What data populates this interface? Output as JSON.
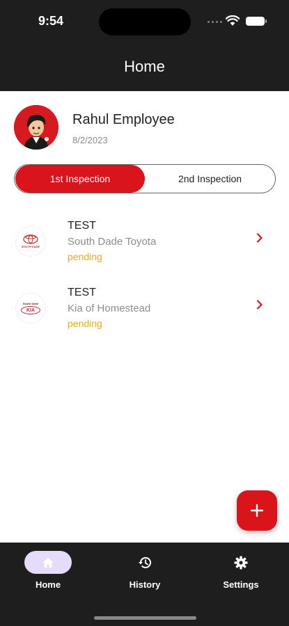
{
  "status_bar": {
    "time": "9:54"
  },
  "header": {
    "title": "Home"
  },
  "profile": {
    "name": "Rahul Employee",
    "date": "8/2/2023"
  },
  "segments": {
    "first": "1st Inspection",
    "second": "2nd Inspection",
    "selected": "1st Inspection"
  },
  "inspections": [
    {
      "title": "TEST",
      "dealer": "South Dade Toyota",
      "status": "pending",
      "logo_icon": "toyota-logo-icon",
      "logo_text": "SOUTH DADE"
    },
    {
      "title": "TEST",
      "dealer": "Kia of Homestead",
      "status": "pending",
      "logo_icon": "kia-logo-icon",
      "logo_top": "South Dade",
      "logo_text": "KIA"
    }
  ],
  "fab": {
    "icon": "plus-icon"
  },
  "tabs": [
    {
      "label": "Home",
      "icon": "home-icon",
      "active": true
    },
    {
      "label": "History",
      "icon": "history-icon",
      "active": false
    },
    {
      "label": "Settings",
      "icon": "gear-icon",
      "active": false
    }
  ],
  "colors": {
    "brand_red": "#d9141a",
    "pending": "#f2a91a",
    "dark_bar": "#1e1e1e",
    "active_tab_pill": "#e6dbf8"
  }
}
